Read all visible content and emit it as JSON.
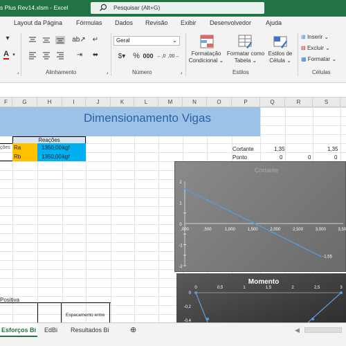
{
  "titlebar": {
    "filename": "s Plus Rev14.xlsm  -  Excel",
    "search_placeholder": "Pesquisar (Alt+G)"
  },
  "menu": [
    "Layout da Página",
    "Fórmulas",
    "Dados",
    "Revisão",
    "Exibir",
    "Desenvolvedor",
    "Ajuda"
  ],
  "ribbon": {
    "alignment_label": "Alinhamento",
    "number_label": "Número",
    "number_format": "Geral",
    "percent": "%",
    "thousands": "000",
    "styles_label": "Estilos",
    "cells_label": "Células",
    "cond_format_1": "Formatação",
    "cond_format_2": "Condicional",
    "table_format_1": "Formatar como",
    "table_format_2": "Tabela",
    "cell_styles_1": "Estilos de",
    "cell_styles_2": "Célula",
    "insert": "Inserir",
    "delete": "Excluir",
    "format": "Formatar"
  },
  "columns": [
    "F",
    "G",
    "H",
    "I",
    "J",
    "K",
    "L",
    "M",
    "N",
    "O",
    "P",
    "Q",
    "R",
    "S"
  ],
  "sheet": {
    "title": "Dimensionamento Vigas",
    "reactions_header": "Reações",
    "row1": {
      "label": "ções",
      "name": "Ra",
      "value": "1350,00",
      "unit": "kgf"
    },
    "row2": {
      "name": "Rb",
      "value": "1350,00",
      "unit": "kgf"
    },
    "cortante_label": "Cortante",
    "cortante_q": "1,35",
    "cortante_s": "1,35",
    "ponto_label": "Ponto",
    "ponto_q": "0",
    "ponto_r": "0",
    "ponto_s": "0",
    "positiva": "Positiva",
    "espacamento": "Espacamento entre"
  },
  "chart_data": [
    {
      "type": "line",
      "title": "Cortante",
      "x": [
        0,
        3
      ],
      "y": [
        1.65,
        -1.55
      ],
      "xlim": [
        0,
        3.2
      ],
      "ylim": [
        -2,
        2
      ],
      "x_ticks": [
        ",000",
        ",500",
        "1,000",
        "1,500",
        "2,000",
        "2,500",
        "3,000",
        "3,500"
      ],
      "y_ticks": [
        "2",
        "1",
        "0",
        "-1",
        "-2"
      ],
      "end_label": "-1,55",
      "color": "#5b9bd5"
    },
    {
      "type": "line",
      "title": "Momento",
      "x_ticks": [
        "0",
        "0,5",
        "1",
        "1,5",
        "2",
        "2,5",
        "3"
      ],
      "y_ticks": [
        "0",
        "-0,2",
        "-0,4"
      ],
      "color": "#5b9bd5"
    }
  ],
  "tabs": {
    "t1": "Esforços Bi",
    "t2": "EdBi",
    "t3": "Resultados Bi"
  },
  "colors": {
    "excel_green": "#217346",
    "title_band": "#9cc2e5",
    "ra_fill": "#ffc000",
    "value_fill": "#00b0f0"
  }
}
